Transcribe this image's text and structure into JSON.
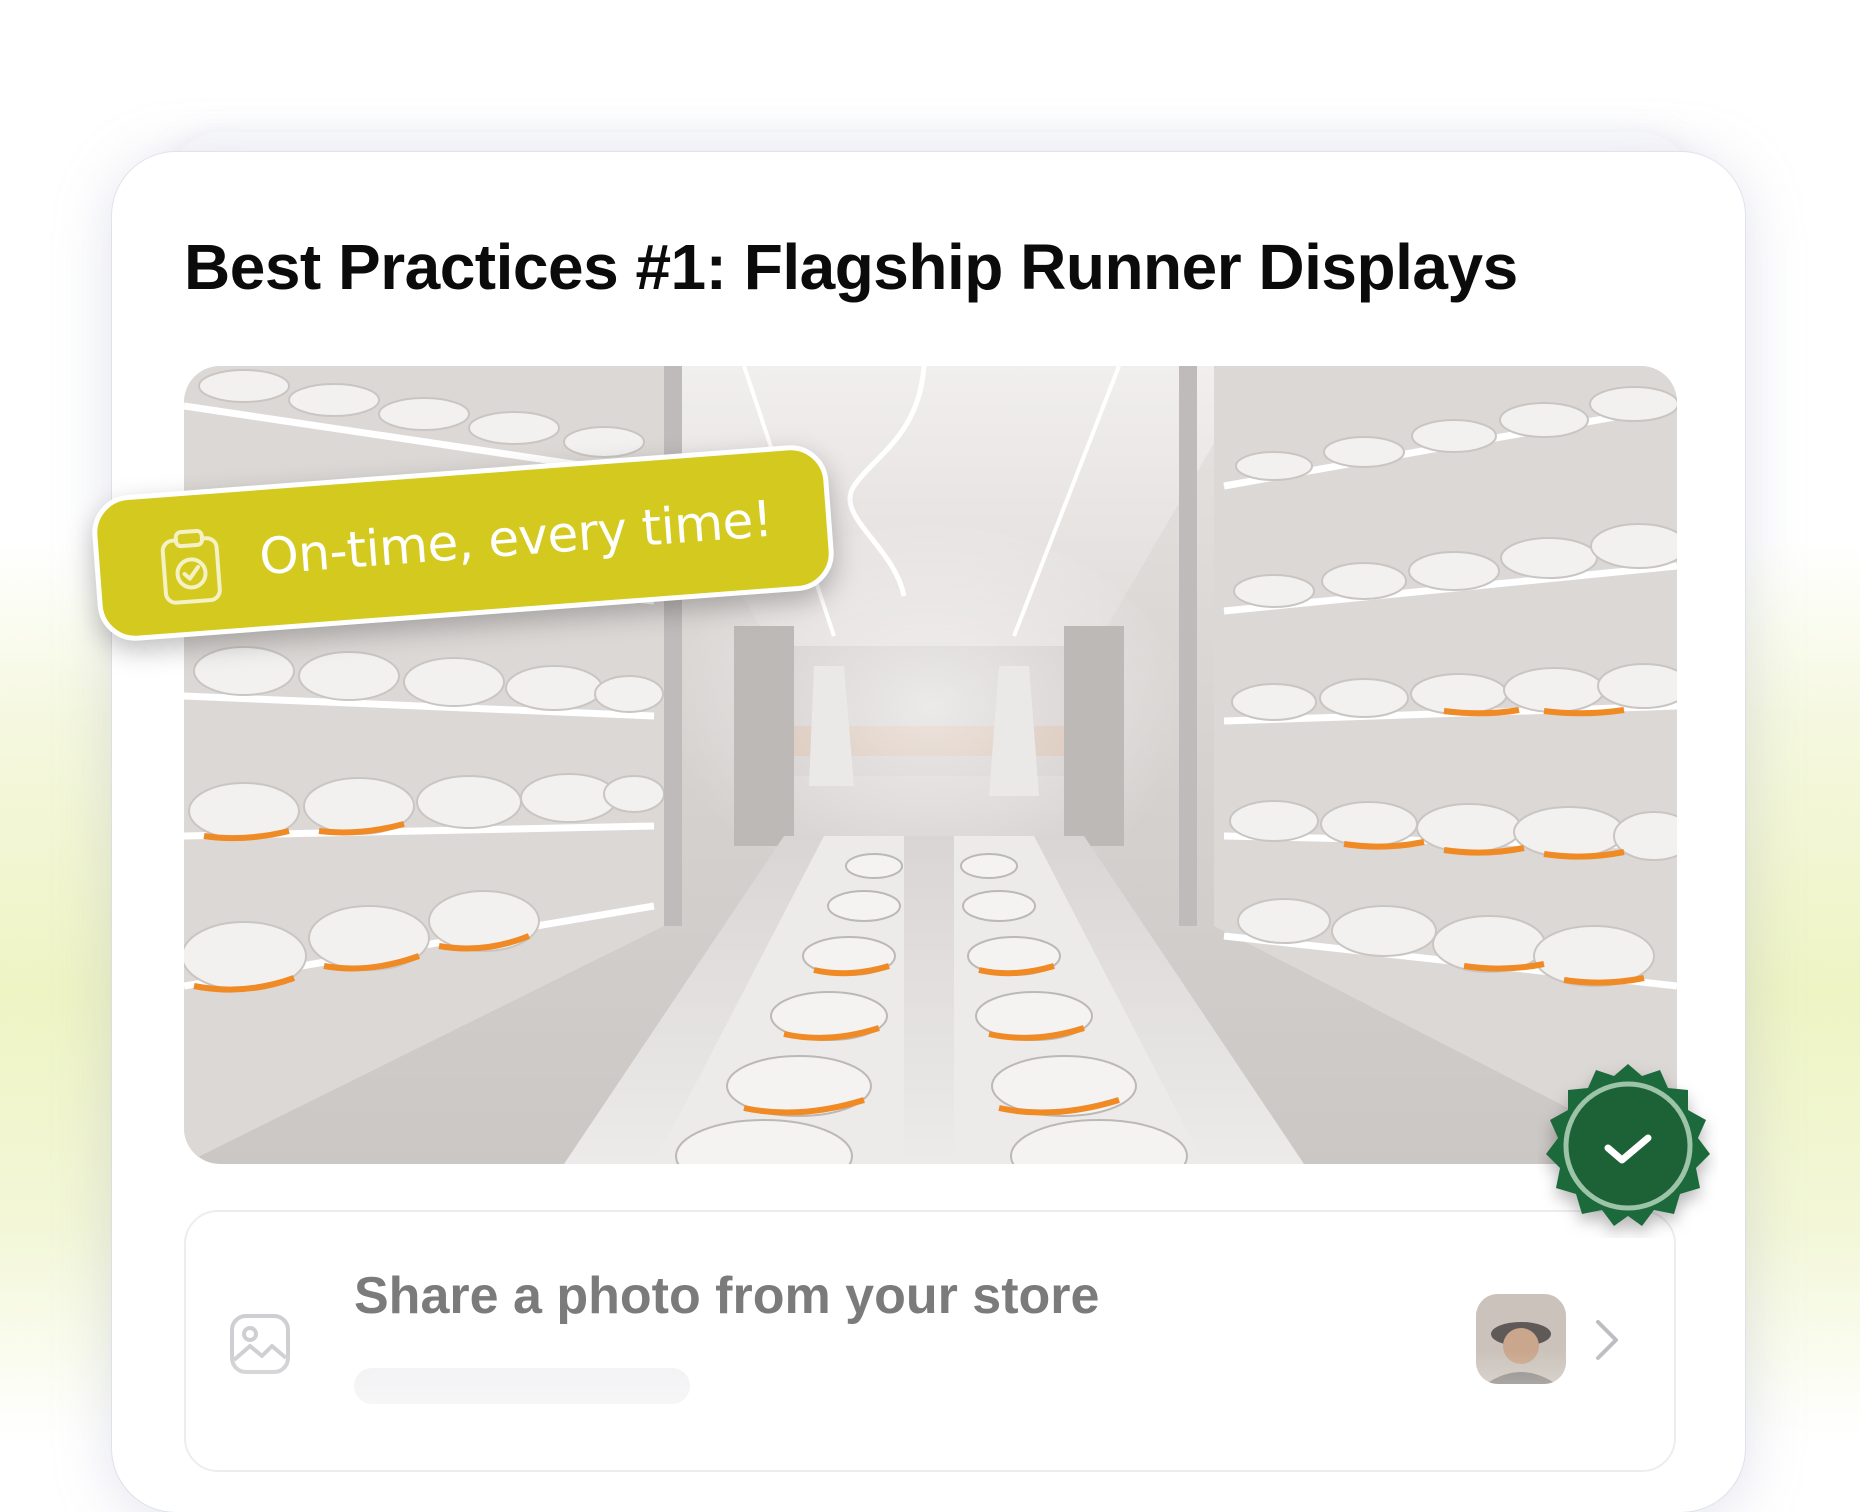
{
  "card": {
    "title": "Best Practices #1: Flagship Runner Displays"
  },
  "photo": {
    "subject": "store-interior-sneaker-display-photo"
  },
  "tag": {
    "text": "On-time, every time!",
    "icon": "clipboard-check-icon",
    "color": "#d3c91f"
  },
  "badge": {
    "icon": "check-icon",
    "color": "#1f6b3b"
  },
  "share": {
    "label": "Share a photo from your store",
    "icon": "image-icon",
    "action_icon": "chevron-right-icon"
  }
}
